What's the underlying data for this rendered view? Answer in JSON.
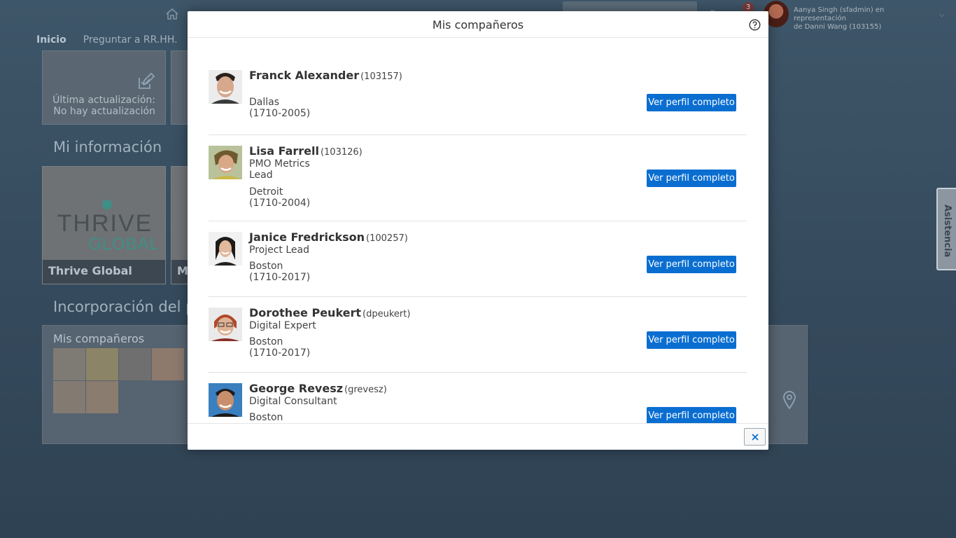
{
  "header": {
    "notification_count": "3",
    "user_line1": "Aanya Singh (sfadmin) en representación",
    "user_line2": "de Danni Wang (103155)"
  },
  "nav": {
    "tabs": [
      {
        "label": "Inicio",
        "active": true
      },
      {
        "label": "Preguntar a RR.HH.",
        "active": false
      }
    ]
  },
  "tiles": {
    "update_line1": "Última actualización:",
    "update_line2": "No hay actualización",
    "section_info": "Mi información",
    "thrive_logo_top": "THRIVE",
    "thrive_logo_bottom": "GLOBAL",
    "thrive_label": "Thrive Global",
    "m_label": "Mi",
    "section_onboarding": "Incorporación del pers",
    "peers_title": "Mis compañeros"
  },
  "side_tab": "Asistencia",
  "dialog": {
    "title": "Mis compañeros",
    "button_label": "Ver perfil completo",
    "people": [
      {
        "name": "Franck Alexander",
        "id": "(103157)",
        "title1": "",
        "title2": "",
        "location": "Dallas",
        "org": "(1710-2005)"
      },
      {
        "name": "Lisa Farrell",
        "id": "(103126)",
        "title1": "PMO Metrics",
        "title2": "Lead",
        "location": "Detroit",
        "org": "(1710-2004)"
      },
      {
        "name": "Janice Fredrickson",
        "id": "(100257)",
        "title1": "Project Lead",
        "title2": "",
        "location": "Boston",
        "org": "(1710-2017)"
      },
      {
        "name": "Dorothee Peukert",
        "id": "(dpeukert)",
        "title1": "Digital Expert",
        "title2": "",
        "location": "Boston",
        "org": "(1710-2017)"
      },
      {
        "name": "George Revesz",
        "id": "(grevesz)",
        "title1": "Digital Consultant",
        "title2": "",
        "location": "Boston",
        "org": ""
      }
    ]
  },
  "colors": {
    "button_blue": "#0a6ed1",
    "overlay_bg": "#3b5367"
  }
}
